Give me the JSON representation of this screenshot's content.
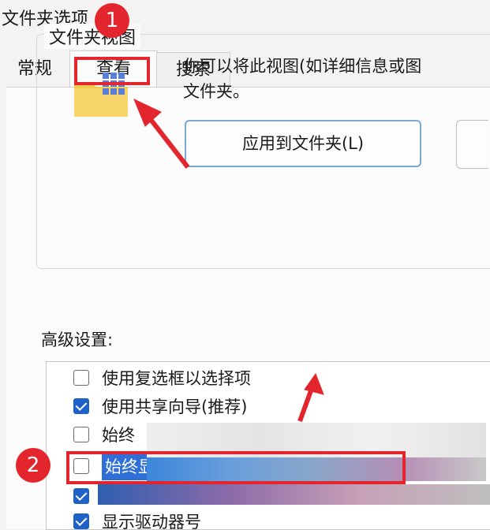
{
  "window": {
    "title": "文件夹选项"
  },
  "tabs": [
    {
      "label": "常规",
      "active": false
    },
    {
      "label": "查看",
      "active": true
    },
    {
      "label": "搜索",
      "active": false
    }
  ],
  "folder_views": {
    "title": "文件夹视图",
    "description": "你可以将此视图(如详细信息或图\n文件夹。",
    "apply_button": "应用到文件夹(L)"
  },
  "advanced": {
    "label": "高级设置:",
    "items": [
      {
        "label": "使用复选框以选择项",
        "checked": false
      },
      {
        "label": "使用共享向导(推荐)",
        "checked": true
      },
      {
        "label": "始终",
        "checked": false
      },
      {
        "label": "始终显",
        "checked": false
      },
      {
        "label": "",
        "checked": true
      },
      {
        "label": "显示驱动器号",
        "checked": true
      }
    ]
  },
  "annotations": {
    "step1": "1",
    "step2": "2",
    "accent": "#e3262e"
  },
  "colors": {
    "checkbox_checked": "#1e62c9",
    "selection": "#2f6fd6",
    "button_border": "#7aa7d8"
  }
}
